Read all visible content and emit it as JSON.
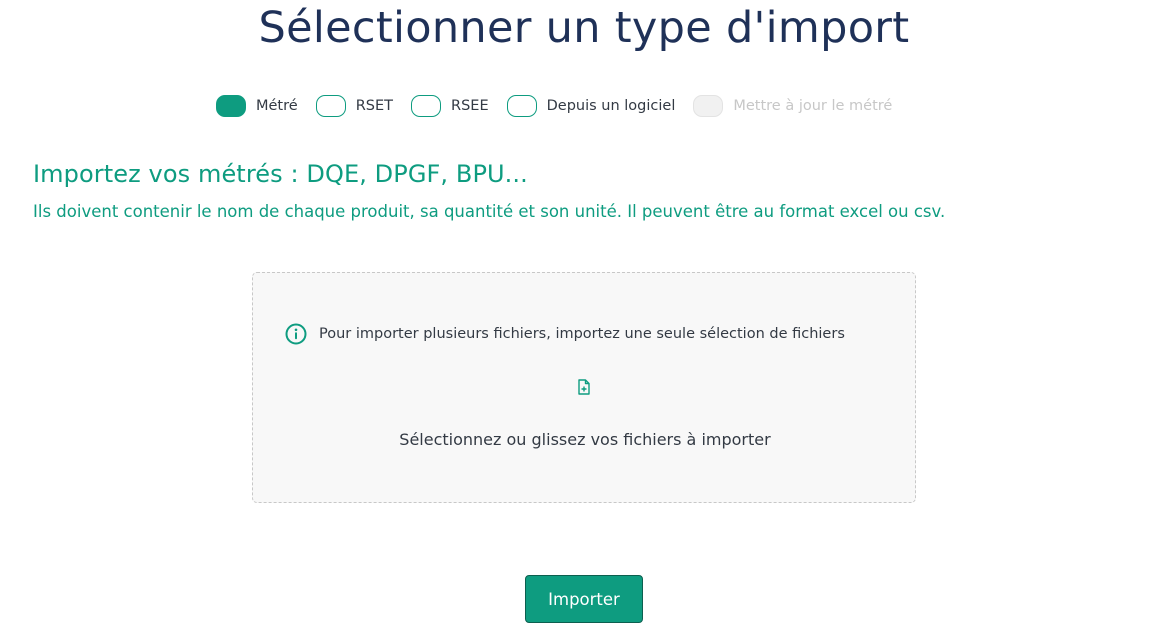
{
  "header": {
    "title": "Sélectionner un type d'import"
  },
  "import_types": {
    "options": [
      {
        "label": "Métré",
        "state": "active"
      },
      {
        "label": "RSET",
        "state": "inactive"
      },
      {
        "label": "RSEE",
        "state": "inactive"
      },
      {
        "label": "Depuis un logiciel",
        "state": "inactive"
      },
      {
        "label": "Mettre à jour le métré",
        "state": "disabled"
      }
    ]
  },
  "section": {
    "heading": "Importez vos métrés : DQE, DPGF, BPU...",
    "description": "Ils doivent contenir le nom de chaque produit, sa quantité et son unité. Il peuvent être au format excel ou csv."
  },
  "dropzone": {
    "info_icon": "info-circle-icon",
    "info_text": "Pour importer plusieurs fichiers, importez une seule sélection de fichiers",
    "file_icon": "file-add-icon",
    "prompt": "Sélectionnez ou glissez vos fichiers à importer"
  },
  "actions": {
    "import_label": "Importer"
  },
  "colors": {
    "accent": "#0e9c80",
    "title": "#1f3158",
    "text": "#333a44",
    "disabled": "#c7c7c7",
    "dropzone_bg": "#f8f8f8"
  }
}
